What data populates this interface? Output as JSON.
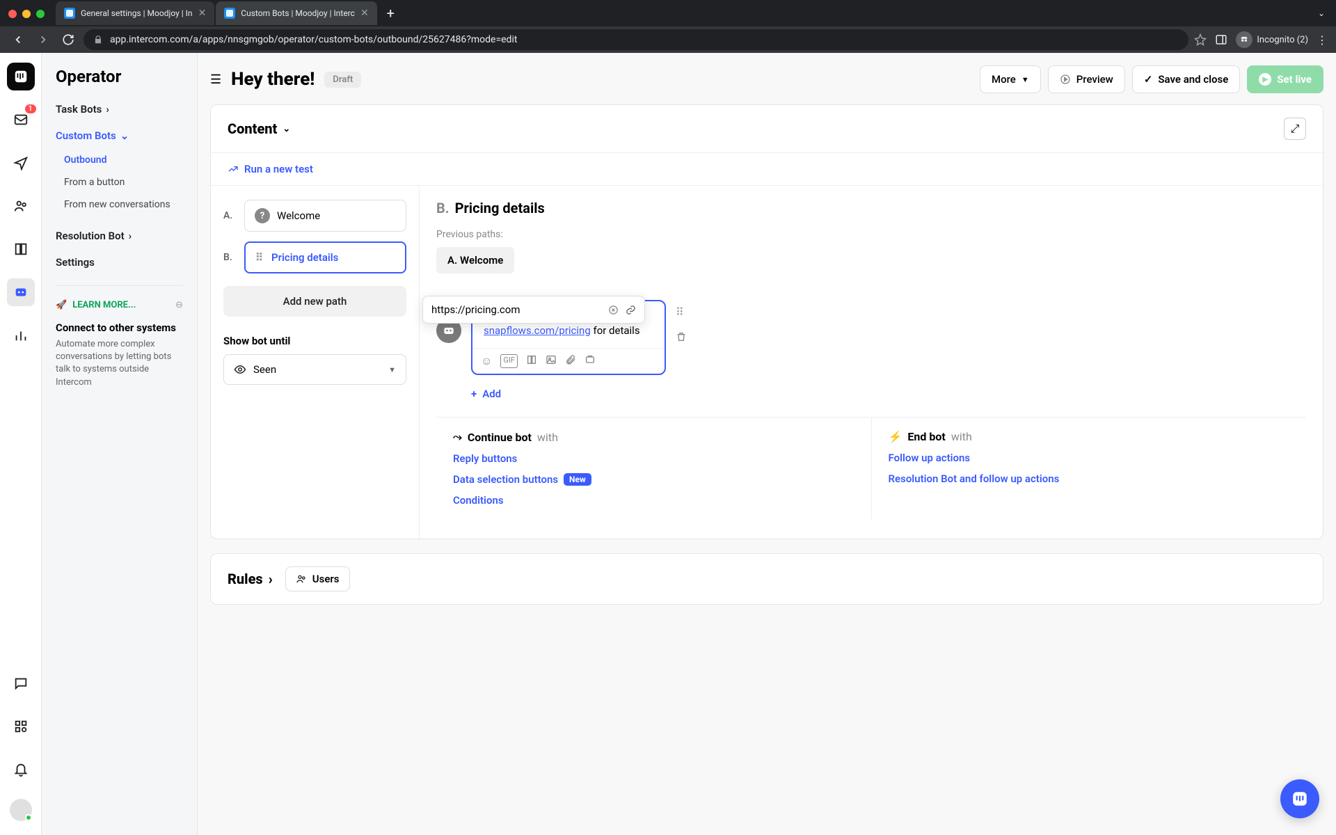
{
  "browser": {
    "tabs": [
      {
        "label": "General settings | Moodjoy | In"
      },
      {
        "label": "Custom Bots | Moodjoy | Interc"
      }
    ],
    "url": "app.intercom.com/a/apps/nnsgmgob/operator/custom-bots/outbound/25627486?mode=edit",
    "incognito": "Incognito (2)"
  },
  "rail": {
    "inbox_badge": "1"
  },
  "sidebar": {
    "title": "Operator",
    "task_bots": "Task Bots",
    "custom_bots": "Custom Bots",
    "outbound": "Outbound",
    "from_button": "From a button",
    "from_new": "From new conversations",
    "resolution_bot": "Resolution Bot",
    "settings": "Settings",
    "learn_more": "LEARN MORE...",
    "connect_title": "Connect to other systems",
    "connect_text": "Automate more complex conversations by letting bots talk to systems outside Intercom"
  },
  "header": {
    "title": "Hey there!",
    "draft": "Draft",
    "more": "More",
    "preview": "Preview",
    "save": "Save and close",
    "setlive": "Set live"
  },
  "content": {
    "title": "Content",
    "run_test": "Run a new test",
    "paths": {
      "a_letter": "A.",
      "a_label": "Welcome",
      "b_letter": "B.",
      "b_label": "Pricing details"
    },
    "add_path": "Add new path",
    "show_until_label": "Show bot until",
    "show_until_value": "Seen",
    "detail": {
      "letter": "B.",
      "title": "Pricing details",
      "prev_label": "Previous paths:",
      "prev_chip": "A. Welcome",
      "url_value": "https://pricing.com",
      "link_text": "snapflows.com/pricing",
      "after_link": " for details",
      "add": "Add"
    },
    "continue": {
      "title": "Continue bot",
      "with": "with",
      "reply": "Reply buttons",
      "data_sel": "Data selection buttons",
      "new_badge": "New",
      "conditions": "Conditions"
    },
    "end": {
      "title": "End bot",
      "with": "with",
      "follow": "Follow up actions",
      "res": "Resolution Bot and follow up actions"
    }
  },
  "rules": {
    "title": "Rules",
    "users": "Users"
  }
}
